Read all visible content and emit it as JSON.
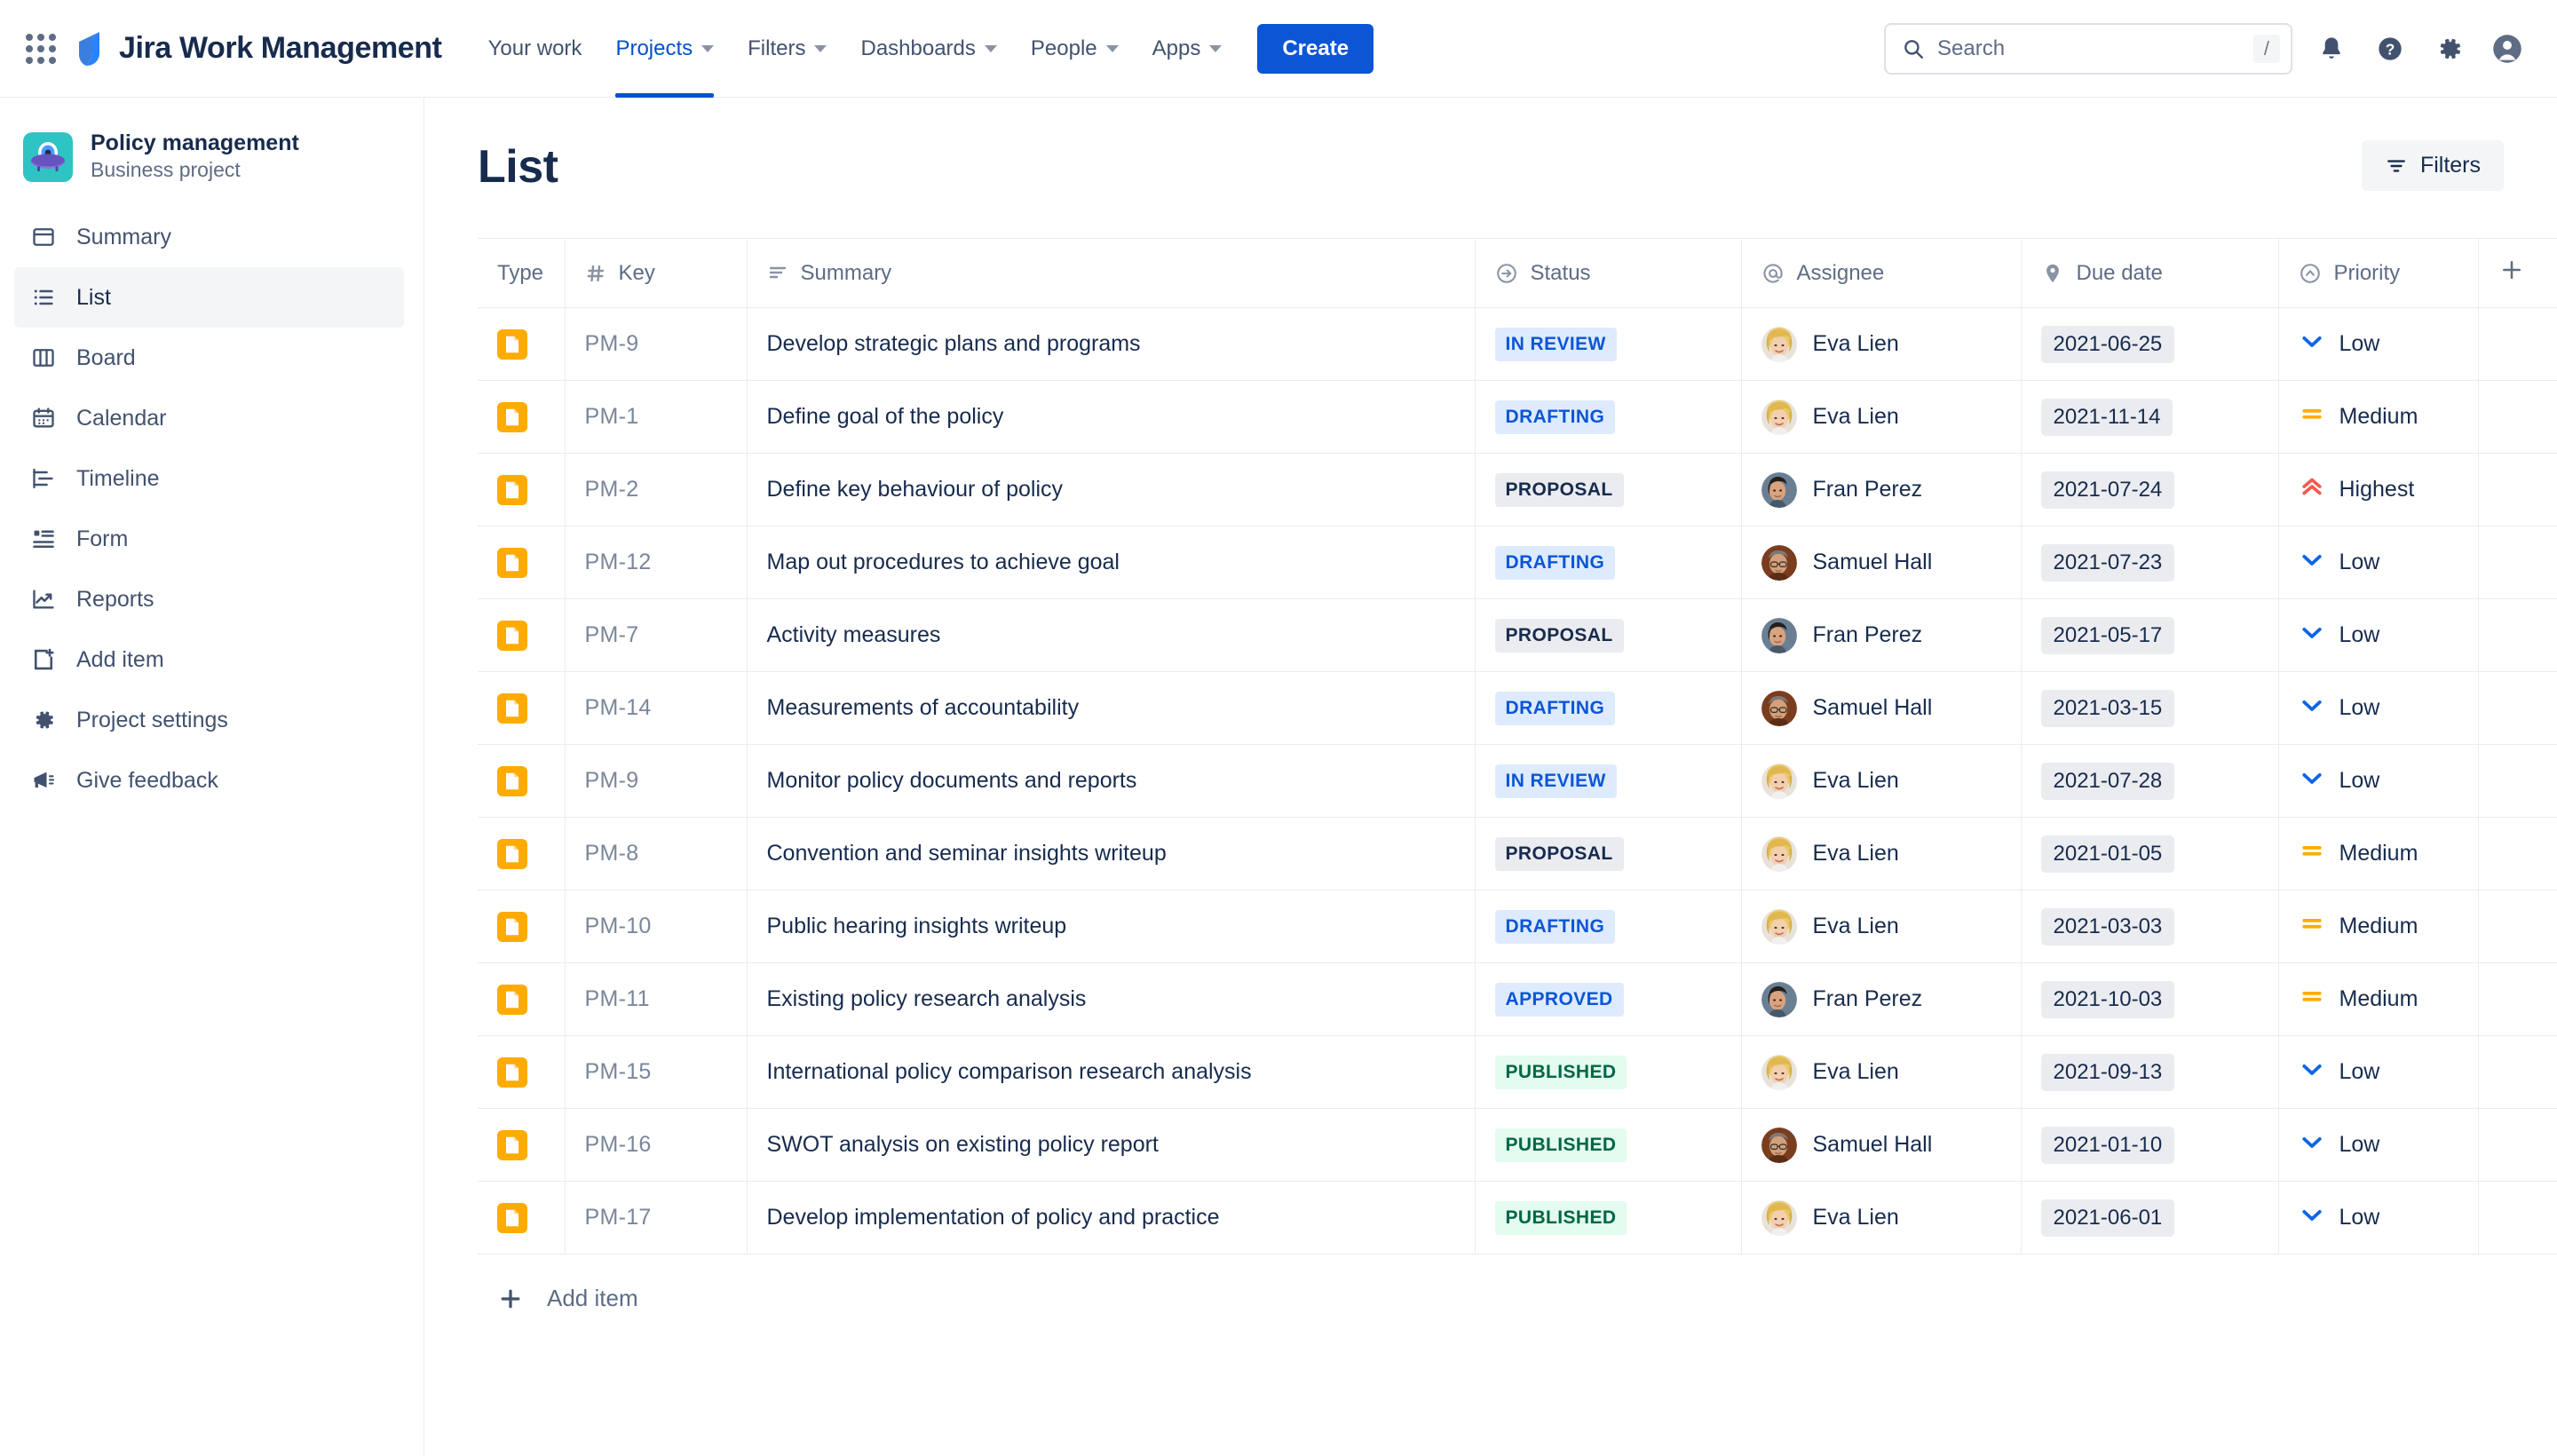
{
  "topnav": {
    "apps_icon": "apps-grid-icon",
    "brand": "Jira Work Management",
    "items": [
      {
        "label": "Your work",
        "has_caret": false,
        "active": false
      },
      {
        "label": "Projects",
        "has_caret": true,
        "active": true
      },
      {
        "label": "Filters",
        "has_caret": true,
        "active": false
      },
      {
        "label": "Dashboards",
        "has_caret": true,
        "active": false
      },
      {
        "label": "People",
        "has_caret": true,
        "active": false
      },
      {
        "label": "Apps",
        "has_caret": true,
        "active": false
      }
    ],
    "create_label": "Create",
    "search": {
      "placeholder": "Search",
      "value": "",
      "shortcut": "/"
    },
    "icons": [
      "notifications-bell-icon",
      "help-question-icon",
      "settings-gear-icon",
      "user-avatar-icon"
    ]
  },
  "sidebar": {
    "project": {
      "name": "Policy management",
      "type": "Business project",
      "avatar": "ufo-avatar"
    },
    "items": [
      {
        "label": "Summary",
        "icon": "summary-icon",
        "selected": false
      },
      {
        "label": "List",
        "icon": "list-icon",
        "selected": true
      },
      {
        "label": "Board",
        "icon": "board-icon",
        "selected": false
      },
      {
        "label": "Calendar",
        "icon": "calendar-icon",
        "selected": false
      },
      {
        "label": "Timeline",
        "icon": "timeline-icon",
        "selected": false
      },
      {
        "label": "Form",
        "icon": "form-icon",
        "selected": false
      },
      {
        "label": "Reports",
        "icon": "reports-chart-icon",
        "selected": false
      },
      {
        "label": "Add item",
        "icon": "add-item-icon",
        "selected": false
      },
      {
        "label": "Project settings",
        "icon": "gear-icon",
        "selected": false
      },
      {
        "label": "Give feedback",
        "icon": "megaphone-icon",
        "selected": false
      }
    ]
  },
  "main": {
    "title": "List",
    "filters_label": "Filters",
    "add_item_label": "Add item",
    "columns": [
      {
        "label": "Type",
        "icon": null
      },
      {
        "label": "Key",
        "icon": "hash-icon"
      },
      {
        "label": "Summary",
        "icon": "lines-icon"
      },
      {
        "label": "Status",
        "icon": "arrow-circle-icon"
      },
      {
        "label": "Assignee",
        "icon": "at-icon"
      },
      {
        "label": "Due date",
        "icon": "tag-icon"
      },
      {
        "label": "Priority",
        "icon": "chevron-circle-icon"
      }
    ],
    "add_column_icon": "plus-icon",
    "rows": [
      {
        "type": "task",
        "key": "PM-9",
        "summary": "Develop strategic plans and programs",
        "status": "IN REVIEW",
        "status_tone": "blue",
        "assignee": "Eva Lien",
        "avatar": "eva",
        "due": "2021-06-25",
        "priority": "Low",
        "priority_icon": "low"
      },
      {
        "type": "task",
        "key": "PM-1",
        "summary": "Define goal of the policy",
        "status": "DRAFTING",
        "status_tone": "blue",
        "assignee": "Eva Lien",
        "avatar": "eva",
        "due": "2021-11-14",
        "priority": "Medium",
        "priority_icon": "medium"
      },
      {
        "type": "task",
        "key": "PM-2",
        "summary": "Define key behaviour of policy",
        "status": "PROPOSAL",
        "status_tone": "gray",
        "assignee": "Fran Perez",
        "avatar": "fran",
        "due": "2021-07-24",
        "priority": "Highest",
        "priority_icon": "highest"
      },
      {
        "type": "task",
        "key": "PM-12",
        "summary": "Map out procedures to achieve goal",
        "status": "DRAFTING",
        "status_tone": "blue",
        "assignee": "Samuel Hall",
        "avatar": "samuel",
        "due": "2021-07-23",
        "priority": "Low",
        "priority_icon": "low"
      },
      {
        "type": "task",
        "key": "PM-7",
        "summary": "Activity measures",
        "status": "PROPOSAL",
        "status_tone": "gray",
        "assignee": "Fran Perez",
        "avatar": "fran",
        "due": "2021-05-17",
        "priority": "Low",
        "priority_icon": "low"
      },
      {
        "type": "task",
        "key": "PM-14",
        "summary": "Measurements of accountability",
        "status": "DRAFTING",
        "status_tone": "blue",
        "assignee": "Samuel Hall",
        "avatar": "samuel",
        "due": "2021-03-15",
        "priority": "Low",
        "priority_icon": "low"
      },
      {
        "type": "task",
        "key": "PM-9",
        "summary": "Monitor policy documents and reports",
        "status": "IN REVIEW",
        "status_tone": "blue",
        "assignee": "Eva Lien",
        "avatar": "eva",
        "due": "2021-07-28",
        "priority": "Low",
        "priority_icon": "low"
      },
      {
        "type": "task",
        "key": "PM-8",
        "summary": "Convention and seminar insights writeup",
        "status": "PROPOSAL",
        "status_tone": "gray",
        "assignee": "Eva Lien",
        "avatar": "eva",
        "due": "2021-01-05",
        "priority": "Medium",
        "priority_icon": "medium"
      },
      {
        "type": "task",
        "key": "PM-10",
        "summary": "Public hearing insights writeup",
        "status": "DRAFTING",
        "status_tone": "blue",
        "assignee": "Eva Lien",
        "avatar": "eva",
        "due": "2021-03-03",
        "priority": "Medium",
        "priority_icon": "medium"
      },
      {
        "type": "task",
        "key": "PM-11",
        "summary": "Existing policy research analysis",
        "status": "APPROVED",
        "status_tone": "blue",
        "assignee": "Fran Perez",
        "avatar": "fran",
        "due": "2021-10-03",
        "priority": "Medium",
        "priority_icon": "medium"
      },
      {
        "type": "task",
        "key": "PM-15",
        "summary": "International policy comparison research analysis",
        "status": "PUBLISHED",
        "status_tone": "green",
        "assignee": "Eva Lien",
        "avatar": "eva",
        "due": "2021-09-13",
        "priority": "Low",
        "priority_icon": "low"
      },
      {
        "type": "task",
        "key": "PM-16",
        "summary": "SWOT analysis on existing policy report",
        "status": "PUBLISHED",
        "status_tone": "green",
        "assignee": "Samuel Hall",
        "avatar": "samuel",
        "due": "2021-01-10",
        "priority": "Low",
        "priority_icon": "low"
      },
      {
        "type": "task",
        "key": "PM-17",
        "summary": "Develop implementation of policy and practice",
        "status": "PUBLISHED",
        "status_tone": "green",
        "assignee": "Eva Lien",
        "avatar": "eva",
        "due": "2021-06-01",
        "priority": "Low",
        "priority_icon": "low"
      }
    ]
  },
  "colors": {
    "brand_blue": "#0c56d6",
    "link_blue": "#0052cc",
    "text_dark": "#172b4d",
    "text_muted": "#5e6c84",
    "type_orange": "#ffab00",
    "priority_low": "#0c66e4",
    "priority_medium": "#ffab00",
    "priority_highest": "#f15b50",
    "status_green": "#006644"
  }
}
